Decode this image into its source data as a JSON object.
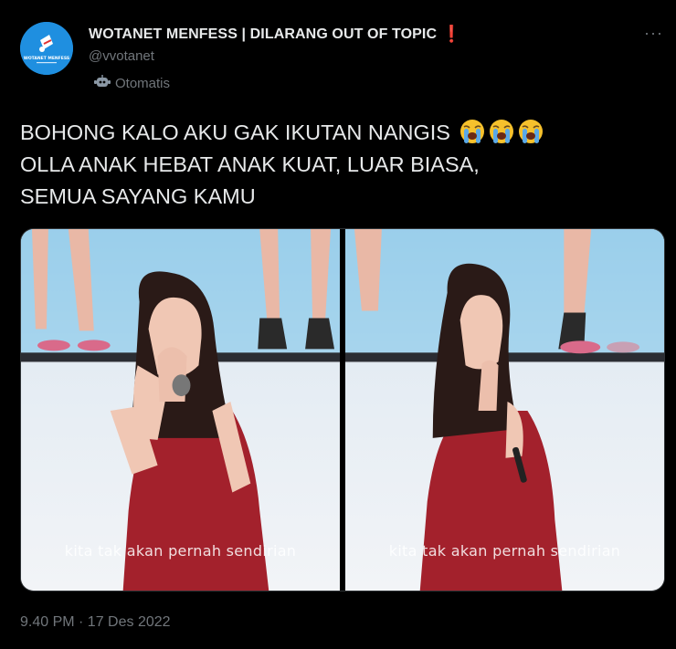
{
  "account": {
    "display_name": "WOTANET MENFESS | DILARANG OUT OF TOPIC",
    "name_emoji": "❗",
    "handle": "@vvotanet",
    "automated_label": "Otomatis",
    "avatar_text": "WOTANET MENFESS"
  },
  "tweet": {
    "line1": "BOHONG KALO AKU GAK IKUTAN NANGIS",
    "line2": "OLLA ANAK HEBAT ANAK KUAT, LUAR BIASA,",
    "line3": "SEMUA SAYANG KAMU",
    "emoji": "loudly-crying-face",
    "emoji_count": 3,
    "timestamp": "9.40 PM · 17 Des 2022"
  },
  "media": {
    "left_caption": "kita tak akan pernah sendirian",
    "right_caption": "kita tak akan pernah sendirian"
  },
  "colors": {
    "background": "#000000",
    "text": "#e7e9ea",
    "secondary": "#71767b",
    "avatar": "#1e8ee0",
    "dress": "#a3212c"
  }
}
